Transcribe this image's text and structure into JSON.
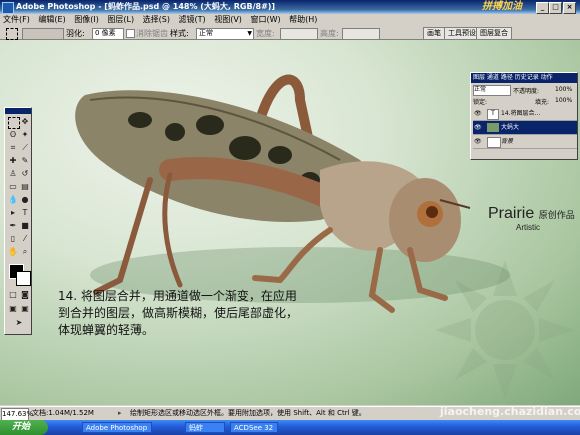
{
  "window": {
    "title": "Adobe Photoshop - [蚂蚱作品.psd @ 148% (大蚂大, RGB/8#)]",
    "brand": "拼搏加油"
  },
  "menu": [
    "文件(F)",
    "编辑(E)",
    "图像(I)",
    "图层(L)",
    "选择(S)",
    "滤镜(T)",
    "视图(V)",
    "窗口(W)",
    "帮助(H)"
  ],
  "options": {
    "feather_label": "羽化:",
    "feather_value": "0 像素",
    "antialias_label": "消除锯齿",
    "style_label": "样式:",
    "style_value": "正常",
    "width_label": "宽度:",
    "height_label": "高度:",
    "wells": [
      "画笔",
      "工具预设",
      "图层复合"
    ]
  },
  "layers_panel": {
    "tabs": "图层 通道 路径 历史记录 动作",
    "blend_mode": "正常",
    "opacity_label": "不透明度:",
    "opacity_value": "100%",
    "lock_label": "锁定:",
    "fill_label": "填充:",
    "fill_value": "100%",
    "layers": [
      {
        "name": "14.将图层合..."
      },
      {
        "name": "大蚂大"
      },
      {
        "name": "背景"
      }
    ]
  },
  "logo": {
    "text": "Prairie",
    "sub": "原创作品",
    "small": "Artistic"
  },
  "caption": "14. 将图层合并，用通道做一个渐变，在应用到合并的图层，做高斯模糊，使后尾部虚化，体现蝉翼的轻薄。",
  "status": {
    "zoom": "147.63%",
    "doc": "文档:1.04M/1.52M",
    "hint": "绘制矩形选区或移动选区外框。要用附加选项，使用 Shift、Alt 和 Ctrl 键。"
  },
  "taskbar": {
    "start": "开始",
    "tasks": [
      "Adobe Photoshop",
      "蚂蚱",
      "ACDSee 32"
    ]
  },
  "watermark": "jiaocheng.chazidian.com"
}
